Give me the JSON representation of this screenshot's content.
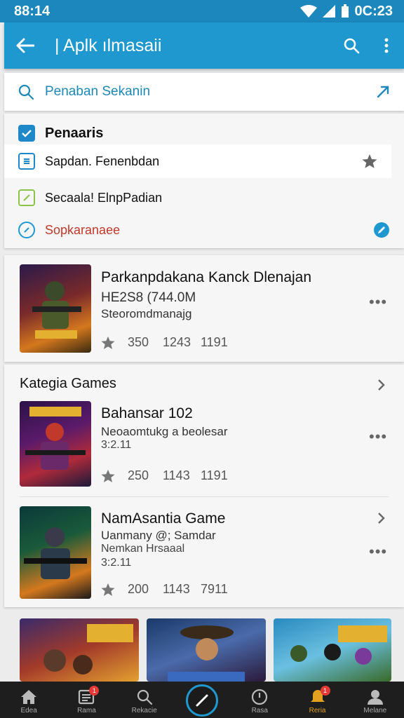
{
  "status": {
    "time_left": "88:14",
    "time_right": "0C:23"
  },
  "appbar": {
    "title": "| Aplk ılmasaii"
  },
  "search": {
    "text": "Penaban Sekanin"
  },
  "filters": {
    "header": "Penaaris",
    "items": [
      {
        "label": "Sapdan. Fenenbdan",
        "icon": "list-icon",
        "color": "#1e88c8"
      },
      {
        "label": "Secaala! ElnpPadian",
        "icon": "image-icon",
        "color": "#8bc34a"
      },
      {
        "label": "Sopkaranaee",
        "icon": "chat-icon",
        "color": "#1e98cf",
        "label_color": "#c0392b"
      }
    ]
  },
  "featured": {
    "title": "Parkanpdakana Kanck Dlenajan",
    "size": "HE2S8 (744.0M",
    "subtitle": "Steoromdmanajg",
    "stats": [
      "350",
      "1243",
      "1191"
    ]
  },
  "category": {
    "title": "Kategia Games",
    "games": [
      {
        "title": "Bahansar 102",
        "sub": "Neoaomtukg a beolesar",
        "version": "3:2.11",
        "stats": [
          "250",
          "1143",
          "1191"
        ]
      },
      {
        "title": "NamAsantia Game",
        "sub": "Uanmany @; Samdar",
        "sub2": "Nemkan Hrsaaal",
        "version": "3:2.11",
        "stats": [
          "200",
          "1143",
          "7911"
        ]
      }
    ]
  },
  "bottom_nav": {
    "items": [
      {
        "label": "Edea",
        "icon": "home-icon"
      },
      {
        "label": "Rama",
        "icon": "news-icon",
        "badge": "1"
      },
      {
        "label": "Rekacie",
        "icon": "search-icon"
      },
      {
        "label": "",
        "icon": "compass-icon"
      },
      {
        "label": "Rasa",
        "icon": "clock-icon"
      },
      {
        "label": "Reria",
        "icon": "bell-icon",
        "badge": "1"
      },
      {
        "label": "Melane",
        "icon": "profile-icon"
      }
    ]
  }
}
